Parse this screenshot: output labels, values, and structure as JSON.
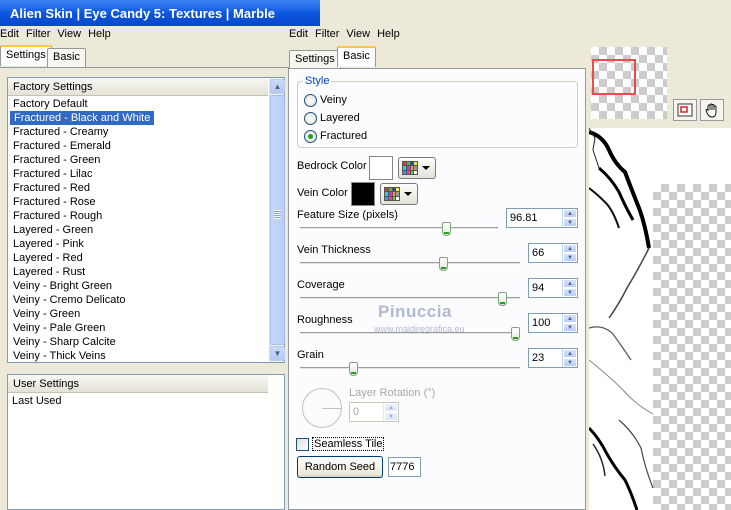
{
  "window": {
    "title": "Alien Skin | Eye Candy 5: Textures | Marble"
  },
  "menu_left": [
    "Edit",
    "Filter",
    "View",
    "Help"
  ],
  "menu_right": [
    "Edit",
    "Filter",
    "View",
    "Help"
  ],
  "left_tabs": [
    "Settings",
    "Basic"
  ],
  "factory": {
    "header": "Factory Settings",
    "selected_index": 1,
    "items": [
      "Factory Default",
      "Fractured - Black and White",
      "Fractured - Creamy",
      "Fractured - Emerald",
      "Fractured - Green",
      "Fractured - Lilac",
      "Fractured - Red",
      "Fractured - Rose",
      "Fractured - Rough",
      "Layered - Green",
      "Layered - Pink",
      "Layered - Red",
      "Layered - Rust",
      "Veiny - Bright Green",
      "Veiny - Cremo Delicato",
      "Veiny - Green",
      "Veiny - Pale Green",
      "Veiny - Sharp Calcite",
      "Veiny - Thick Veins"
    ]
  },
  "user": {
    "header": "User Settings",
    "items": [
      "Last Used"
    ]
  },
  "right_tabs": [
    "Settings",
    "Basic"
  ],
  "style": {
    "legend": "Style",
    "options": [
      "Veiny",
      "Layered",
      "Fractured"
    ],
    "selected": "Fractured"
  },
  "bedrock": {
    "label": "Bedrock Color",
    "color": "#ffffff"
  },
  "vein": {
    "label": "Vein Color",
    "color": "#000000"
  },
  "sliders": {
    "feature_size": {
      "label": "Feature Size (pixels)",
      "value": "96.81",
      "fraction": 0.75
    },
    "vein_thickness": {
      "label": "Vein Thickness",
      "value": "66",
      "fraction": 0.66
    },
    "coverage": {
      "label": "Coverage",
      "value": "94",
      "fraction": 0.94
    },
    "roughness": {
      "label": "Roughness",
      "value": "100",
      "fraction": 1.0
    },
    "grain": {
      "label": "Grain",
      "value": "23",
      "fraction": 0.23
    }
  },
  "layer_rotation": {
    "label": "Layer Rotation (°)",
    "value": "0"
  },
  "seamless": {
    "label": "Seamless Tile",
    "checked": false
  },
  "random_seed": {
    "label": "Random Seed",
    "value": "7776"
  },
  "watermark": {
    "name": "Pinuccia",
    "url": "www.maidiregrafica.eu"
  },
  "icons": {
    "navigator": "navigator-icon",
    "hand": "hand-icon"
  }
}
